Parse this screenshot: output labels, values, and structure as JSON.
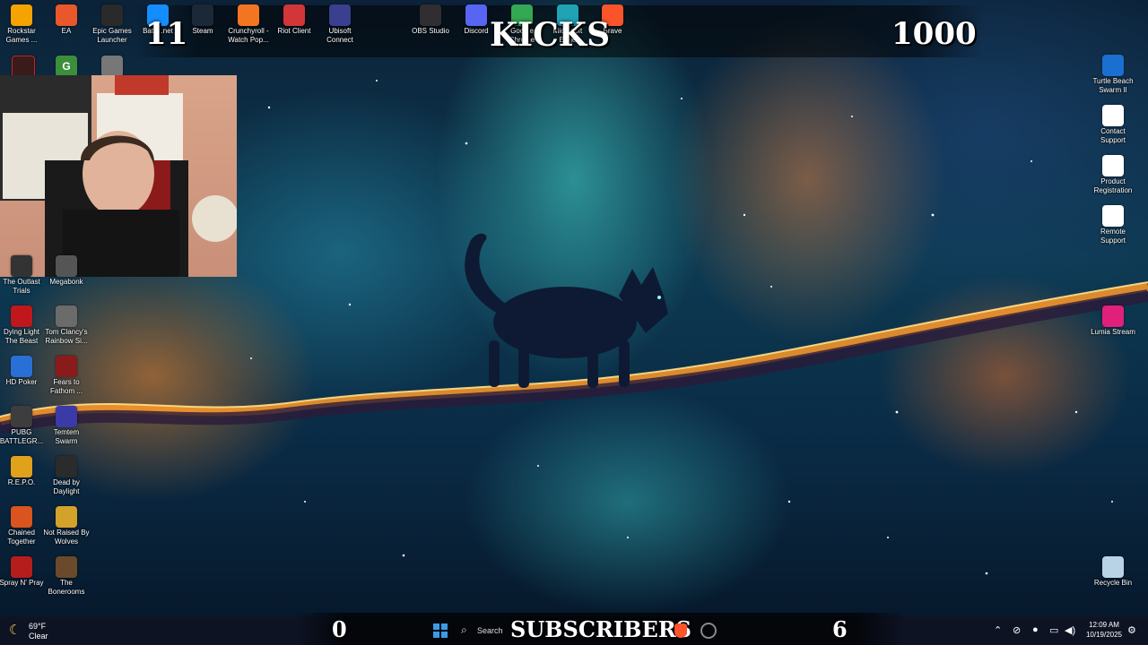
{
  "overlay": {
    "top_left_count": "11",
    "top_title": "KICKS",
    "top_right_count": "1000",
    "bottom_left_count": "0",
    "bottom_title": "SUBSCRIBERS",
    "bottom_right_count": "6"
  },
  "desktop_top_icons": [
    {
      "label": "Rockstar Games ...",
      "icon": "rockstar-icon",
      "color": "#f4a300"
    },
    {
      "label": "EA",
      "icon": "ea-icon",
      "color": "#e8582c"
    },
    {
      "label": "Epic Games Launcher",
      "icon": "epic-icon",
      "color": "#2a2a2a"
    },
    {
      "label": "Battle.net",
      "icon": "battlenet-icon",
      "color": "#148eff"
    },
    {
      "label": "Steam",
      "icon": "steam-icon",
      "color": "#1b2838"
    },
    {
      "label": "Crunchyroll - Watch Pop...",
      "icon": "crunchyroll-icon",
      "color": "#f47521"
    },
    {
      "label": "Riot Client",
      "icon": "riot-icon",
      "color": "#d13639"
    },
    {
      "label": "Ubisoft Connect",
      "icon": "ubisoft-icon",
      "color": "#3b3f8f"
    },
    {
      "label": "OBS Studio",
      "icon": "obs-icon",
      "color": "#302e31"
    },
    {
      "label": "Discord",
      "icon": "discord-icon",
      "color": "#5865f2"
    },
    {
      "label": "Google Chrome",
      "icon": "chrome-icon",
      "color": "#34a853"
    },
    {
      "label": "Microsoft Edge",
      "icon": "edge-icon",
      "color": "#1fa3b5"
    },
    {
      "label": "Brave",
      "icon": "brave-icon",
      "color": "#fb542b"
    }
  ],
  "desktop_left_icons": [
    {
      "label": "The Outlast Trials",
      "icon": "outlast-icon",
      "color": "#333333"
    },
    {
      "label": "Megabonk",
      "icon": "megabonk-icon",
      "color": "#555555"
    },
    {
      "label": "Dying Light The Beast",
      "icon": "dying-light-icon",
      "color": "#c0171c"
    },
    {
      "label": "Tom Clancy's Rainbow Si...",
      "icon": "rainbow-six-icon",
      "color": "#6b6b6b"
    },
    {
      "label": "HD Poker",
      "icon": "hd-poker-icon",
      "color": "#2a6fd6"
    },
    {
      "label": "Fears to Fathom ...",
      "icon": "fears-to-fathom-icon",
      "color": "#8a1b1b"
    },
    {
      "label": "PUBG BATTLEGR...",
      "icon": "pubg-icon",
      "color": "#3d3d3d"
    },
    {
      "label": "Temtem Swarm",
      "icon": "temtem-icon",
      "color": "#3a3aa8"
    },
    {
      "label": "R.E.P.O.",
      "icon": "repo-icon",
      "color": "#e0a11b"
    },
    {
      "label": "Dead by Daylight",
      "icon": "dbd-icon",
      "color": "#2b2b2b"
    },
    {
      "label": "Chained Together",
      "icon": "chained-icon",
      "color": "#d9541e"
    },
    {
      "label": "Not Raised By Wolves",
      "icon": "wolves-icon",
      "color": "#d3a22a"
    },
    {
      "label": "Spray N' Pray",
      "icon": "spray-icon",
      "color": "#b51d1d"
    },
    {
      "label": "The Bonerooms",
      "icon": "bonerooms-icon",
      "color": "#6a4a2a"
    }
  ],
  "desktop_right_icons": [
    {
      "label": "Turtle Beach Swarm II",
      "icon": "turtle-beach-icon",
      "color": "#1a6fd1"
    },
    {
      "label": "Contact Support",
      "icon": "contact-support-icon",
      "color": "#ffffff"
    },
    {
      "label": "Product Registration",
      "icon": "product-registration-icon",
      "color": "#ffffff"
    },
    {
      "label": "Remote Support",
      "icon": "remote-support-icon",
      "color": "#ffffff"
    },
    {
      "label": "Lumia Stream",
      "icon": "lumia-icon",
      "color": "#e0207a"
    },
    {
      "label": "Recycle Bin",
      "icon": "recycle-bin-icon",
      "color": "#b9d3e6"
    }
  ],
  "taskbar": {
    "weather_temp": "69°F",
    "weather_desc": "Clear",
    "search_placeholder": "Search",
    "time": "12:09 AM",
    "date": "10/19/2025"
  }
}
